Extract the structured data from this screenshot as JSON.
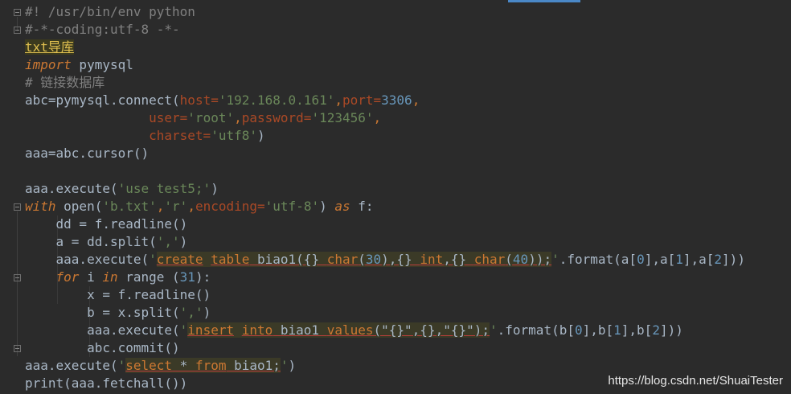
{
  "editor": {
    "lines": [
      [
        {
          "t": "#! /usr/bin/env python",
          "c": "cmt"
        }
      ],
      [
        {
          "t": "#-*-coding:utf-8 -*-",
          "c": "cmt"
        }
      ],
      [
        {
          "t": "txt导库",
          "c": "txt-label"
        }
      ],
      [
        {
          "t": "import",
          "c": "kw"
        },
        {
          "t": " pymysql",
          "c": ""
        }
      ],
      [
        {
          "t": "# 链接数据库",
          "c": "cmt"
        }
      ],
      [
        {
          "t": "abc=pymysql.",
          "c": ""
        },
        {
          "t": "connect",
          "c": ""
        },
        {
          "t": "(",
          "c": ""
        },
        {
          "t": "host=",
          "c": "param"
        },
        {
          "t": "'192.168.0.161'",
          "c": "str"
        },
        {
          "t": ",",
          "c": "kwn"
        },
        {
          "t": "port=",
          "c": "param"
        },
        {
          "t": "3306",
          "c": "num"
        },
        {
          "t": ",",
          "c": "kwn"
        }
      ],
      [
        {
          "t": "                ",
          "c": ""
        },
        {
          "t": "user=",
          "c": "param"
        },
        {
          "t": "'root'",
          "c": "str"
        },
        {
          "t": ",",
          "c": "kwn"
        },
        {
          "t": "password=",
          "c": "param"
        },
        {
          "t": "'123456'",
          "c": "str"
        },
        {
          "t": ",",
          "c": "kwn"
        }
      ],
      [
        {
          "t": "                ",
          "c": ""
        },
        {
          "t": "charset=",
          "c": "param"
        },
        {
          "t": "'utf8'",
          "c": "str"
        },
        {
          "t": ")",
          "c": ""
        }
      ],
      [
        {
          "t": "aaa=abc.cursor()",
          "c": ""
        }
      ],
      [
        {
          "t": "",
          "c": ""
        }
      ],
      [
        {
          "t": "aaa.execute(",
          "c": ""
        },
        {
          "t": "'use test5;'",
          "c": "str"
        },
        {
          "t": ")",
          "c": ""
        }
      ],
      [
        {
          "t": "with",
          "c": "kw"
        },
        {
          "t": " open(",
          "c": ""
        },
        {
          "t": "'b.txt'",
          "c": "str"
        },
        {
          "t": ",",
          "c": "kwn"
        },
        {
          "t": "'r'",
          "c": "str"
        },
        {
          "t": ",",
          "c": "kwn"
        },
        {
          "t": "encoding=",
          "c": "param"
        },
        {
          "t": "'utf-8'",
          "c": "str"
        },
        {
          "t": ") ",
          "c": ""
        },
        {
          "t": "as",
          "c": "kw"
        },
        {
          "t": " f:",
          "c": ""
        }
      ],
      [
        {
          "t": "    dd = f.readline()",
          "c": ""
        }
      ],
      [
        {
          "t": "    a = dd.split(",
          "c": ""
        },
        {
          "t": "','",
          "c": "str"
        },
        {
          "t": ")",
          "c": ""
        }
      ],
      [
        {
          "t": "    aaa.execute(",
          "c": ""
        },
        {
          "t": "'",
          "c": "str"
        },
        {
          "t": "create",
          "c": "sqlkw hl"
        },
        {
          "t": " ",
          "c": "hl"
        },
        {
          "t": "table",
          "c": "sqlkw hl"
        },
        {
          "t": " biao1({} ",
          "c": "sqltxt hl"
        },
        {
          "t": "char",
          "c": "sqlkw hl"
        },
        {
          "t": "(",
          "c": "sqltxt hl"
        },
        {
          "t": "30",
          "c": "sqlnum hl"
        },
        {
          "t": "),{} ",
          "c": "sqltxt hl"
        },
        {
          "t": "int",
          "c": "sqlkw hl"
        },
        {
          "t": ",{} ",
          "c": "sqltxt hl"
        },
        {
          "t": "char",
          "c": "sqlkw hl"
        },
        {
          "t": "(",
          "c": "sqltxt hl"
        },
        {
          "t": "40",
          "c": "sqlnum hl"
        },
        {
          "t": "));",
          "c": "sqltxt hl"
        },
        {
          "t": "'",
          "c": "str"
        },
        {
          "t": ".format(a[",
          "c": ""
        },
        {
          "t": "0",
          "c": "num"
        },
        {
          "t": "],a[",
          "c": ""
        },
        {
          "t": "1",
          "c": "num"
        },
        {
          "t": "],a[",
          "c": ""
        },
        {
          "t": "2",
          "c": "num"
        },
        {
          "t": "]))",
          "c": ""
        }
      ],
      [
        {
          "t": "    ",
          "c": ""
        },
        {
          "t": "for",
          "c": "kw"
        },
        {
          "t": " i ",
          "c": ""
        },
        {
          "t": "in",
          "c": "kw"
        },
        {
          "t": " range (",
          "c": ""
        },
        {
          "t": "31",
          "c": "num"
        },
        {
          "t": "):",
          "c": ""
        }
      ],
      [
        {
          "t": "        x = f.readline()",
          "c": ""
        }
      ],
      [
        {
          "t": "        b = x.split(",
          "c": ""
        },
        {
          "t": "','",
          "c": "str"
        },
        {
          "t": ")",
          "c": ""
        }
      ],
      [
        {
          "t": "        aaa.execute(",
          "c": ""
        },
        {
          "t": "'",
          "c": "str"
        },
        {
          "t": "insert",
          "c": "sqlkw hl"
        },
        {
          "t": " ",
          "c": "hl"
        },
        {
          "t": "into",
          "c": "sqlkw hl"
        },
        {
          "t": " biao1 ",
          "c": "sqltxt hl"
        },
        {
          "t": "values",
          "c": "sqlkw hl"
        },
        {
          "t": "(\"{}\",{},\"{}\");",
          "c": "sqltxt hl"
        },
        {
          "t": "'",
          "c": "str"
        },
        {
          "t": ".format(b[",
          "c": ""
        },
        {
          "t": "0",
          "c": "num"
        },
        {
          "t": "],b[",
          "c": ""
        },
        {
          "t": "1",
          "c": "num"
        },
        {
          "t": "],b[",
          "c": ""
        },
        {
          "t": "2",
          "c": "num"
        },
        {
          "t": "]))",
          "c": ""
        }
      ],
      [
        {
          "t": "        abc.commit()",
          "c": ""
        }
      ],
      [
        {
          "t": "aaa.execute(",
          "c": ""
        },
        {
          "t": "'",
          "c": "str"
        },
        {
          "t": "select",
          "c": "sqlkw hl"
        },
        {
          "t": " * ",
          "c": "sqltxt hl"
        },
        {
          "t": "from",
          "c": "sqlkw hl"
        },
        {
          "t": " biao1;",
          "c": "sqltxt hl"
        },
        {
          "t": "'",
          "c": "str"
        },
        {
          "t": ")",
          "c": ""
        }
      ],
      [
        {
          "t": "print(aaa.fetchall())",
          "c": ""
        }
      ]
    ]
  },
  "watermark": "https://blog.csdn.net/ShuaiTester"
}
